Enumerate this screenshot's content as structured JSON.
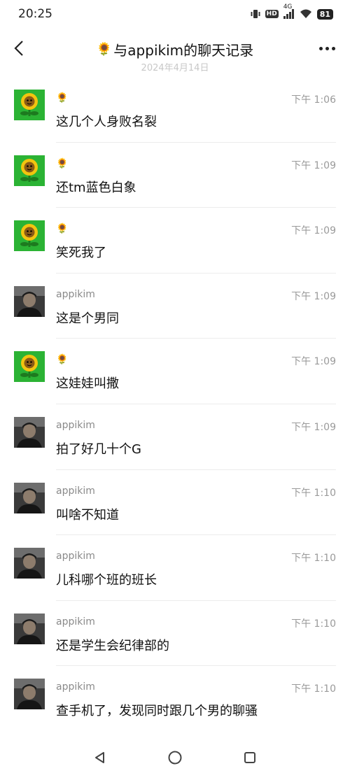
{
  "status_bar": {
    "time": "20:25",
    "hd_label": "HD",
    "network": "4G",
    "battery": "81"
  },
  "header": {
    "title_icon": "🌻",
    "title": "与appikim的聊天记录"
  },
  "date_divider": "2024年4月14日",
  "messages": [
    {
      "sender": "🌻",
      "avatar": "sunflower",
      "time": "下午 1:06",
      "text": "这几个人身败名裂"
    },
    {
      "sender": "🌻",
      "avatar": "sunflower",
      "time": "下午 1:09",
      "text": "还tm蓝色白象"
    },
    {
      "sender": "🌻",
      "avatar": "sunflower",
      "time": "下午 1:09",
      "text": "笑死我了"
    },
    {
      "sender": "appikim",
      "avatar": "person",
      "time": "下午 1:09",
      "text": "这是个男同"
    },
    {
      "sender": "🌻",
      "avatar": "sunflower",
      "time": "下午 1:09",
      "text": "这娃娃叫撒"
    },
    {
      "sender": "appikim",
      "avatar": "person",
      "time": "下午 1:09",
      "text": "拍了好几十个G"
    },
    {
      "sender": "appikim",
      "avatar": "person",
      "time": "下午 1:10",
      "text": "叫啥不知道"
    },
    {
      "sender": "appikim",
      "avatar": "person",
      "time": "下午 1:10",
      "text": "儿科哪个班的班长"
    },
    {
      "sender": "appikim",
      "avatar": "person",
      "time": "下午 1:10",
      "text": "还是学生会纪律部的"
    },
    {
      "sender": "appikim",
      "avatar": "person",
      "time": "下午 1:10",
      "text": "查手机了，发现同时跟几个男的聊骚"
    }
  ],
  "icons": {
    "back": "chevron-left-icon",
    "more": "more-dots-icon",
    "nav_back": "triangle-back-icon",
    "nav_home": "circle-home-icon",
    "nav_recent": "square-recent-icon"
  }
}
